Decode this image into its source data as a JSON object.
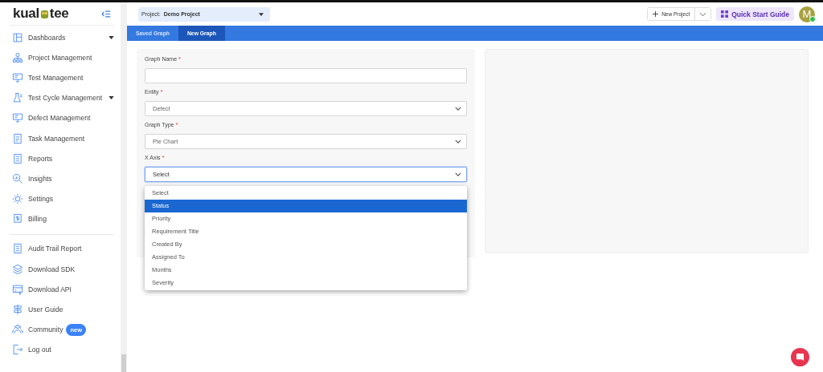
{
  "sidebar": {
    "logo": "kual",
    "logo_end": "tee",
    "items": [
      {
        "label": "Dashboards",
        "expandable": true
      },
      {
        "label": "Project Management",
        "expandable": false
      },
      {
        "label": "Test Management",
        "expandable": false
      },
      {
        "label": "Test Cycle Management",
        "expandable": true
      },
      {
        "label": "Defect Management",
        "expandable": false
      },
      {
        "label": "Task Management",
        "expandable": false
      },
      {
        "label": "Reports",
        "expandable": false
      },
      {
        "label": "Insights",
        "expandable": false
      },
      {
        "label": "Settings",
        "expandable": false
      },
      {
        "label": "Billing",
        "expandable": false
      }
    ],
    "bottom_items": [
      {
        "label": "Audit Trail Report"
      },
      {
        "label": "Download SDK"
      },
      {
        "label": "Download API"
      },
      {
        "label": "User Guide"
      },
      {
        "label": "Community",
        "badge": "new"
      },
      {
        "label": "Log out"
      }
    ]
  },
  "header": {
    "project_label": "Project:",
    "project": "Demo Project",
    "new_project": "New Project",
    "quick_start": "Quick Start Guide",
    "avatar": "M"
  },
  "tabs": [
    {
      "label": "Saved Graph",
      "selected": false
    },
    {
      "label": "New Graph",
      "selected": true
    }
  ],
  "form": {
    "fields": [
      {
        "kind": "text",
        "label": "Graph Name",
        "required_mark": "*"
      },
      {
        "kind": "select",
        "label": "Entity",
        "required_mark": "*",
        "value": "Defect"
      },
      {
        "kind": "select",
        "label": "Graph Type",
        "required_mark": "*",
        "value": "Pie Chart"
      },
      {
        "kind": "select",
        "label": "X Axis",
        "required_mark": "*",
        "value": "Select",
        "focused": true
      }
    ]
  },
  "dropdown": {
    "options": [
      {
        "label": "Select",
        "selected": false
      },
      {
        "label": "Status",
        "selected": true
      },
      {
        "label": "Priority",
        "selected": false
      },
      {
        "label": "Requirement Title",
        "selected": false
      },
      {
        "label": "Created By",
        "selected": false
      },
      {
        "label": "Assigned To",
        "selected": false
      },
      {
        "label": "Months",
        "selected": false
      },
      {
        "label": "Severity",
        "selected": false
      }
    ]
  }
}
